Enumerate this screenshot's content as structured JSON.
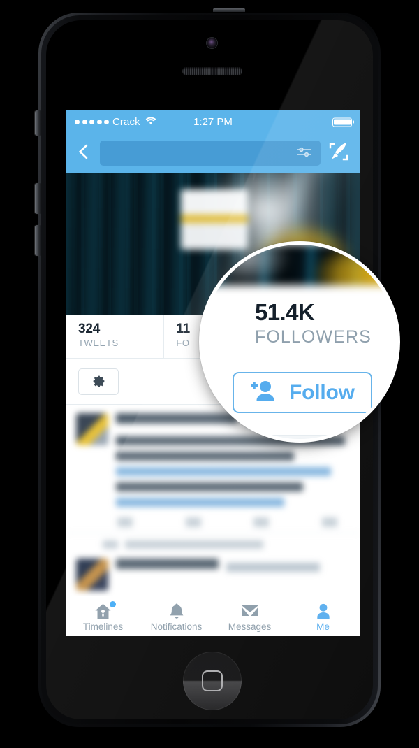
{
  "device": {
    "name": "iphone-5",
    "color": "black-slate",
    "hardware": {
      "camera": "front-camera",
      "speaker": "earpiece-speaker",
      "home_button": "home-button",
      "power_button": "power-button",
      "mute_switch": "mute-switch",
      "volume_up": "volume-up-button",
      "volume_down": "volume-down-button"
    }
  },
  "statusbar": {
    "carrier": "Crack",
    "signal_dots": 5,
    "wifi_icon": "wifi-icon",
    "time": "1:27 PM",
    "battery_icon": "battery-full-icon",
    "bg_color": "#5bb4ea"
  },
  "navbar": {
    "back_icon": "back-chevron-icon",
    "search_placeholder": "",
    "search_value": "",
    "filter_icon": "sliders-filter-icon",
    "compose_icon": "compose-quill-icon",
    "bg_color": "#5bb4ea"
  },
  "profile": {
    "banner_alt": "profile-banner-image",
    "stats": [
      {
        "value": "324",
        "label": "TWEETS"
      },
      {
        "value": "11",
        "label": "FO"
      }
    ],
    "settings_icon": "gear-icon"
  },
  "timeline": {
    "tweets": [
      {
        "avatar": "avatar-1",
        "name_blurred": true,
        "has_link": true
      },
      {
        "avatar": "avatar-2",
        "retweet_header": true
      }
    ]
  },
  "tabbar": {
    "items": [
      {
        "label": "Timelines",
        "icon": "home-icon",
        "active": false,
        "badge": true
      },
      {
        "label": "Notifications",
        "icon": "bell-icon",
        "active": false,
        "badge": false
      },
      {
        "label": "Messages",
        "icon": "envelope-icon",
        "active": false,
        "badge": false
      },
      {
        "label": "Me",
        "icon": "person-icon",
        "active": true,
        "badge": false
      }
    ],
    "active_color": "#55acee",
    "inactive_color": "#8899a6"
  },
  "magnifier": {
    "followers": {
      "value": "51.4K",
      "label": "FOLLOWERS"
    },
    "follow_button": {
      "label": "Follow",
      "icon": "person-add-icon",
      "color": "#55acee",
      "border_color": "#68b4ea"
    }
  }
}
